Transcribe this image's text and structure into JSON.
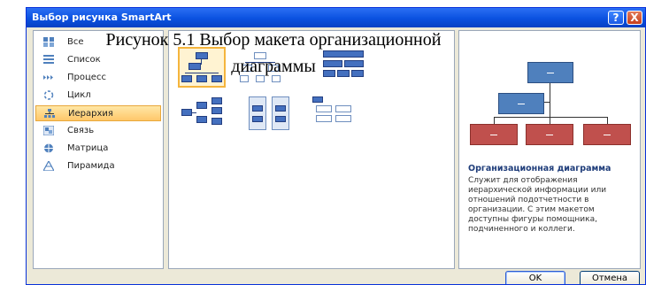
{
  "caption": {
    "line1": "Рисунок 5.1 Выбор макета организационной",
    "line2": "диаграммы"
  },
  "window": {
    "title": "Выбор рисунка SmartArt",
    "help_label": "?",
    "close_label": "X"
  },
  "categories": [
    {
      "label": "Все",
      "icon": "all-layouts-icon"
    },
    {
      "label": "Список",
      "icon": "list-icon"
    },
    {
      "label": "Процесс",
      "icon": "process-icon"
    },
    {
      "label": "Цикл",
      "icon": "cycle-icon"
    },
    {
      "label": "Иерархия",
      "icon": "hierarchy-icon",
      "selected": true
    },
    {
      "label": "Связь",
      "icon": "relationship-icon"
    },
    {
      "label": "Матрица",
      "icon": "matrix-icon"
    },
    {
      "label": "Пирамида",
      "icon": "pyramid-icon"
    }
  ],
  "preview": {
    "title": "Организационная диаграмма",
    "description": "Служит для отображения иерархической информации или отношений подотчетности в организации. С этим макетом доступны фигуры помощника, подчиненного и коллеги."
  },
  "buttons": {
    "ok": "OK",
    "cancel": "Отмена"
  },
  "colors": {
    "titlebar": "#0a51e0",
    "selection": "#ffc76a",
    "preview_top": "#4f80bd",
    "preview_bottom": "#c0504d"
  }
}
